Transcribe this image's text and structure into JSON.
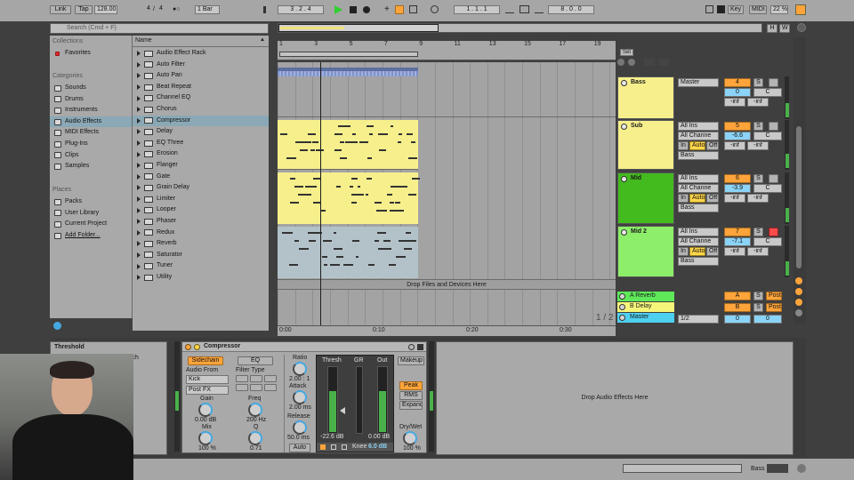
{
  "toolbar": {
    "link": "Link",
    "tap": "Tap",
    "tempo": "128.00",
    "sig_num": "4",
    "sig_den": "4",
    "metro": "●○",
    "quant": "1 Bar",
    "position": "3 .   2 .   4",
    "loop_start": "1 .   1 .   1",
    "loop_len": "8 .   0 .   0",
    "key": "Key",
    "midi": "MIDI",
    "cpu": "22 %",
    "h": "H",
    "w": "W"
  },
  "browser": {
    "search_placeholder": "Search (Cmd + F)",
    "collections_title": "Collections",
    "collections": [
      {
        "label": "Favorites"
      }
    ],
    "categories_title": "Categories",
    "categories": [
      {
        "label": "Sounds"
      },
      {
        "label": "Drums"
      },
      {
        "label": "Instruments"
      },
      {
        "label": "Audio Effects"
      },
      {
        "label": "MIDI Effects"
      },
      {
        "label": "Plug-Ins"
      },
      {
        "label": "Clips"
      },
      {
        "label": "Samples"
      }
    ],
    "places_title": "Places",
    "places": [
      {
        "label": "Packs"
      },
      {
        "label": "User Library"
      },
      {
        "label": "Current Project"
      },
      {
        "label": "Add Folder..."
      }
    ],
    "name_header": "Name",
    "items": [
      "Audio Effect Rack",
      "Auto Filter",
      "Auto Pan",
      "Beat Repeat",
      "Channel EQ",
      "Chorus",
      "Compressor",
      "Delay",
      "EQ Three",
      "Erosion",
      "Flanger",
      "Gate",
      "Grain Delay",
      "Limiter",
      "Looper",
      "Phaser",
      "Redux",
      "Reverb",
      "Saturator",
      "Tuner",
      "Utility"
    ]
  },
  "arrangement": {
    "ruler": [
      "1",
      "3",
      "5",
      "7",
      "9",
      "11",
      "13",
      "15",
      "17",
      "19"
    ],
    "time": [
      "0:00",
      "0:10",
      "0:20",
      "0:30"
    ],
    "set": "Set",
    "drop_text": "Drop Files and Devices Here",
    "page": "1 / 2"
  },
  "tracks": [
    {
      "name": "Bass",
      "input": "Master",
      "num": "4",
      "vol": "0",
      "pan": "C",
      "send_a": "-inf",
      "send_b": "-inf"
    },
    {
      "name": "Sub",
      "input": "All Ins",
      "channel": "All Channe",
      "num": "5",
      "vol": "-6.6",
      "pan": "C",
      "monitor": [
        "In",
        "Auto",
        "Off"
      ],
      "output": "Bass",
      "send_a": "-inf",
      "send_b": "-inf"
    },
    {
      "name": "Mid",
      "input": "All Ins",
      "channel": "All Channe",
      "num": "6",
      "vol": "-3.9",
      "pan": "C",
      "monitor": [
        "In",
        "Auto",
        "Off"
      ],
      "output": "Bass",
      "send_a": "-inf",
      "send_b": "-inf"
    },
    {
      "name": "Mid 2",
      "input": "All Ins",
      "channel": "All Channe",
      "num": "7",
      "vol": "-7.1",
      "pan": "C",
      "monitor": [
        "In",
        "Auto",
        "Off"
      ],
      "output": "Bass",
      "send_a": "-inf",
      "send_b": "-inf"
    }
  ],
  "returns": [
    {
      "name": "A Reverb",
      "num": "A",
      "s": "S",
      "post": "Post"
    },
    {
      "name": "B Delay",
      "num": "B",
      "s": "S",
      "post": "Post"
    },
    {
      "name": "Master",
      "num": "0",
      "vol": "0",
      "cue": "1/2"
    }
  ],
  "info": {
    "title": "Threshold",
    "fragment": "ich"
  },
  "compressor": {
    "title": "Compressor",
    "sidechain": "Sidechain",
    "eq": "EQ",
    "audio_from": "Audio From",
    "source": "Kick",
    "tap": "Post FX",
    "filter_type": "Filter Type",
    "gain_label": "Gain",
    "gain_val": "0.00 dB",
    "mix_label": "Mix",
    "mix_val": "100 %",
    "freq_label": "Freq",
    "freq_val": "200 Hz",
    "q_label": "Q",
    "q_val": "0.71",
    "ratio_label": "Ratio",
    "ratio_val": "2.00 : 1",
    "attack_label": "Attack",
    "attack_val": "2.00 ms",
    "release_label": "Release",
    "release_val": "50.0 ms",
    "auto": "Auto",
    "thresh_label": "Thresh",
    "gr_label": "GR",
    "out_label": "Out",
    "thresh_val": "-22.6 dB",
    "out_val": "0.00 dB",
    "knee_label": "Knee",
    "knee_val": "6.0 dB",
    "makeup": "Makeup",
    "peak": "Peak",
    "rms": "RMS",
    "expand": "Expand",
    "drywet_label": "Dry/Wet",
    "drywet_val": "100 %"
  },
  "device_drop": "Drop Audio Effects Here",
  "status": {
    "track": "Bass"
  }
}
